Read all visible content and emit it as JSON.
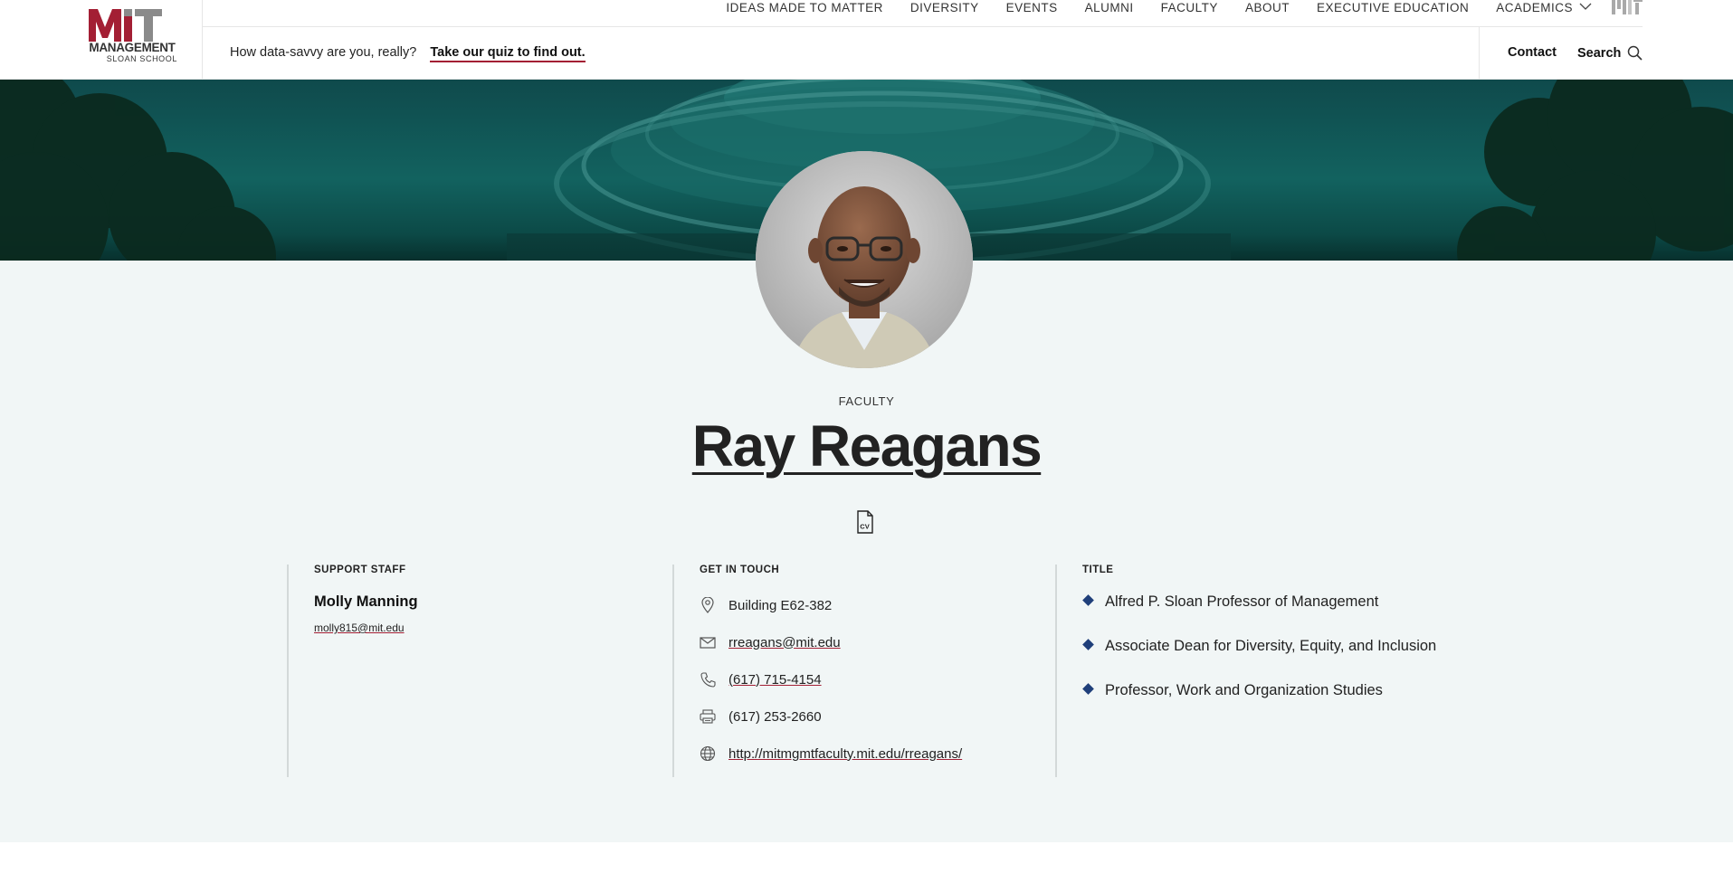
{
  "brand": {
    "logo_mit": "MIT",
    "logo_management": "MANAGEMENT",
    "logo_sloan": "SLOAN SCHOOL",
    "accent_color": "#a31f34"
  },
  "nav": {
    "items": [
      {
        "label": "IDEAS MADE TO MATTER"
      },
      {
        "label": "DIVERSITY"
      },
      {
        "label": "EVENTS"
      },
      {
        "label": "ALUMNI"
      },
      {
        "label": "FACULTY"
      },
      {
        "label": "ABOUT"
      },
      {
        "label": "EXECUTIVE EDUCATION"
      },
      {
        "label": "ACADEMICS"
      }
    ],
    "dropdown_icon": "chevron-down-icon"
  },
  "promo": {
    "text": "How data-savvy are you, really?",
    "link": "Take our quiz to find out."
  },
  "utility": {
    "contact": "Contact",
    "search": "Search"
  },
  "profile": {
    "eyebrow": "FACULTY",
    "name": "Ray Reagans",
    "cv_icon": "cv-document-icon"
  },
  "support": {
    "heading": "SUPPORT STAFF",
    "name": "Molly Manning",
    "email": "molly815@mit.edu"
  },
  "contact": {
    "heading": "GET IN TOUCH",
    "building": "Building E62-382",
    "email": "rreagans@mit.edu",
    "phone": "(617) 715-4154",
    "fax": "(617) 253-2660",
    "website": "http://mitmgmtfaculty.mit.edu/rreagans/"
  },
  "titles": {
    "heading": "TITLE",
    "items": [
      "Alfred P. Sloan Professor of Management",
      "Associate Dean for Diversity, Equity, and Inclusion",
      "Professor, Work and Organization Studies"
    ]
  },
  "colors": {
    "hero": "#12625f",
    "profile_bg": "#f1f6f6",
    "bullet": "#1f3f7a"
  }
}
